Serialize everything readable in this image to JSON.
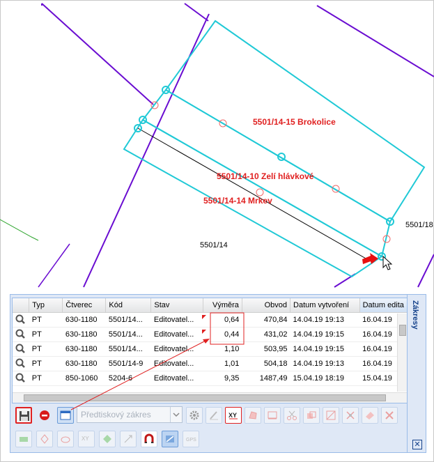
{
  "map": {
    "parcel_labels": [
      {
        "text": "5501/14-15 Brokolice"
      },
      {
        "text": "5501/14-10 Zelí hlávkové"
      },
      {
        "text": "5501/14-14 Mrkev"
      },
      {
        "text": "5501/14"
      },
      {
        "text": "5501/18"
      }
    ]
  },
  "panel": {
    "title": "Zákresy",
    "close_symbol": "✕",
    "columns": [
      "Typ",
      "Čtverec",
      "Kód",
      "Stav",
      "Výměra",
      "Obvod",
      "Datum vytvoření",
      "Datum edita"
    ],
    "rows": [
      [
        "PT",
        "630-1180",
        "5501/14...",
        "Editovatel...",
        "0,64",
        "470,84",
        "14.04.19 19:13",
        "16.04.19"
      ],
      [
        "PT",
        "630-1180",
        "5501/14...",
        "Editovatel...",
        "0,44",
        "431,02",
        "14.04.19 19:15",
        "16.04.19"
      ],
      [
        "PT",
        "630-1180",
        "5501/14...",
        "Editovatel...",
        "1,10",
        "503,95",
        "14.04.19 19:15",
        "16.04.19"
      ],
      [
        "PT",
        "630-1180",
        "5501/14-9",
        "Editovatel...",
        "1,01",
        "504,18",
        "14.04.19 19:13",
        "16.04.19"
      ],
      [
        "PT",
        "850-1060",
        "5204-6",
        "Editovatel...",
        "9,35",
        "1487,49",
        "15.04.19 18:19",
        "15.04.19"
      ]
    ],
    "combo_placeholder": "Předtiskový zákres"
  },
  "toolbar_icons": [
    "save-icon",
    "cancel-icon",
    "window-icon",
    "gear-icon",
    "pencil-icon",
    "xy-icon",
    "draw-polygon-icon",
    "edit-rectangle-icon",
    "cut-icon",
    "copy-icon",
    "split-icon",
    "merge-icon",
    "erase-icon",
    "layers-icon",
    "move-icon",
    "erase-area-icon",
    "xy-point-icon",
    "fill-icon",
    "arrow-icon",
    "magnet-icon",
    "snap-icon",
    "gps-icon"
  ],
  "colors": {
    "parcel_boundary": "#6a0dd1",
    "selected_parcel": "#20c9d6",
    "label_red": "#e02020",
    "annotation_red": "#e02020",
    "panel_border": "#99bbe8"
  }
}
